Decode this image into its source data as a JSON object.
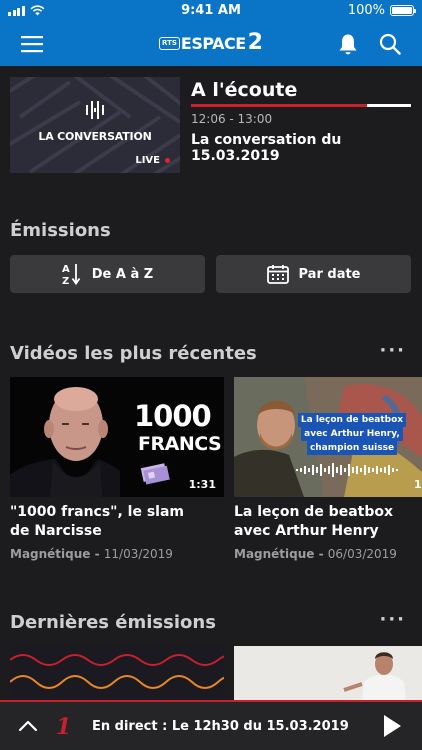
{
  "status_bar": {
    "time": "9:41 AM",
    "battery": "100%"
  },
  "app": {
    "logo_rts": "RTS",
    "logo_name": "ESPACE",
    "logo_number": "2"
  },
  "now_playing": {
    "heading": "A l'écoute",
    "thumbnail_title": "LA CONVERSATION",
    "live_badge": "LIVE",
    "time_range": "12:06 - 13:00",
    "show_title": "La conversation du 15.03.2019",
    "progress": 0.8
  },
  "emissions": {
    "heading": "Émissions",
    "filters": [
      {
        "label": "De A à Z",
        "icon": "sort-az-icon"
      },
      {
        "label": "Par date",
        "icon": "calendar-icon"
      }
    ]
  },
  "recent_videos": {
    "heading": "Vidéos les plus récentes",
    "more": "···",
    "items": [
      {
        "title": "\"1000 francs\", le slam de Narcisse",
        "program": "Magnétique - ",
        "date": "11/03/2019",
        "duration": "1:31",
        "overlay_line1": "1000",
        "overlay_line2": "FRANCS"
      },
      {
        "title": "La leçon de beatbox avec Arthur Henry",
        "program": "Magnétique - ",
        "date": "06/03/2019",
        "duration": "1",
        "overlay_line1": "La leçon de beatbox",
        "overlay_line2": "avec Arthur Henry,",
        "overlay_line3": "champion suisse"
      }
    ]
  },
  "latest_shows": {
    "heading": "Dernières émissions",
    "more": "···"
  },
  "player": {
    "channel_number": "1",
    "label": "En direct : Le 12h30 du 15.03.2019"
  },
  "colors": {
    "brand_blue": "#0a74c7",
    "background": "#1c1c1e",
    "accent_red": "#c8202c"
  }
}
